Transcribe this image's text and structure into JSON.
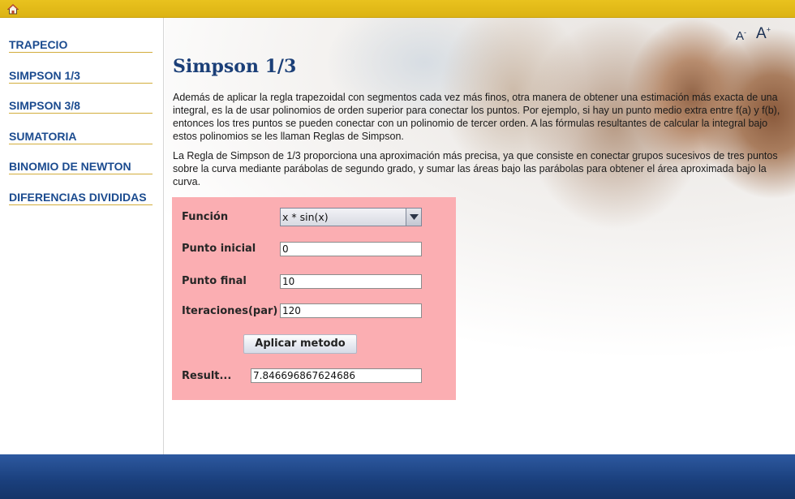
{
  "nav": {
    "items": [
      {
        "label": "TRAPECIO"
      },
      {
        "label": "SIMPSON 1/3"
      },
      {
        "label": "SIMPSON 3/8"
      },
      {
        "label": "SUMATORIA"
      },
      {
        "label": "BINOMIO DE NEWTON"
      },
      {
        "label": "DIFERENCIAS DIVIDIDAS"
      }
    ]
  },
  "font_controls": {
    "decrease": "A",
    "decrease_sup": "-",
    "increase": "A",
    "increase_sup": "+"
  },
  "main": {
    "title": "Simpson 1/3",
    "paragraph1": "Además de aplicar la regla trapezoidal con segmentos cada vez más finos, otra manera de obtener una estimación más exacta de una integral, es la de usar polinomios de orden superior para conectar los puntos. Por ejemplo, si hay un punto medio extra entre f(a) y f(b), entonces los tres puntos se pueden conectar con un polinomio de tercer orden. A las fórmulas resultantes de calcular la integral bajo estos polinomios se les llaman Reglas de Simpson.",
    "paragraph2": "La Regla de Simpson de 1/3 proporciona una aproximación más precisa, ya que consiste en conectar grupos sucesivos de tres puntos sobre la curva mediante parábolas de segundo grado, y sumar las áreas bajo las parábolas para obtener el área aproximada bajo la curva."
  },
  "form": {
    "funcion_label": "Función",
    "funcion_value": "x * sin(x)",
    "punto_inicial_label": "Punto inicial",
    "punto_inicial_value": "0",
    "punto_final_label": "Punto final",
    "punto_final_value": "10",
    "iteraciones_label": "Iteraciones(par)",
    "iteraciones_value": "120",
    "apply_label": "Aplicar metodo",
    "result_label": "Result...",
    "result_value": "7.846696867624686"
  },
  "colors": {
    "accent_top": "#e0b816",
    "nav_text": "#1b4b8f",
    "panel": "#fbaeb2",
    "footer": "#1f4787"
  },
  "icons": {
    "home": "home-icon",
    "combo_arrow": "chevron-down-icon"
  }
}
